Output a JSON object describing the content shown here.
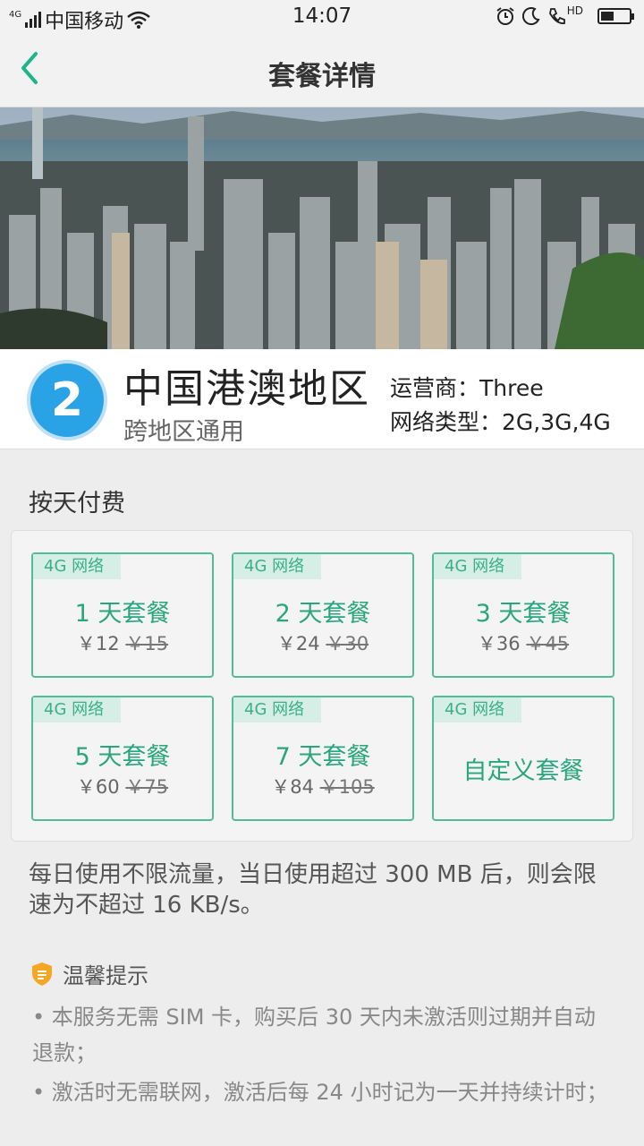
{
  "status_bar": {
    "network": "4G",
    "carrier": "中国移动",
    "time": "14:07",
    "hd": "HD"
  },
  "nav": {
    "back_icon": "chevron-left-icon",
    "title": "套餐详情"
  },
  "region": {
    "badge_number": "2",
    "name": "中国港澳地区",
    "subtitle": "跨地区通用",
    "operator": "运营商：Three",
    "network_types": "网络类型：2G,3G,4G"
  },
  "section_title": "按天付费",
  "plans": [
    {
      "tag": "4G 网络",
      "name": "1 天套餐",
      "price": "￥12",
      "original": "￥15"
    },
    {
      "tag": "4G 网络",
      "name": "2 天套餐",
      "price": "￥24",
      "original": "￥30"
    },
    {
      "tag": "4G 网络",
      "name": "3 天套餐",
      "price": "￥36",
      "original": "￥45"
    },
    {
      "tag": "4G 网络",
      "name": "5 天套餐",
      "price": "￥60",
      "original": "￥75"
    },
    {
      "tag": "4G 网络",
      "name": "7 天套餐",
      "price": "￥84",
      "original": "￥105"
    },
    {
      "tag": "4G 网络",
      "name": "自定义套餐"
    }
  ],
  "description": "每日使用不限流量，当日使用超过 300 MB 后，则会限速为不超过 16 KB/s。",
  "tips": {
    "title": "温馨提示",
    "items": [
      "• 本服务无需 SIM 卡，购买后 30 天内未激活则过期并自动退款；",
      "• 激活时无需联网，激活后每 24 小时记为一天并持续计时；"
    ]
  },
  "colors": {
    "accent": "#1fb58a",
    "plan_border": "#4fbd9a",
    "tag_bg": "#d6eee5",
    "badge": "#2aa3e6"
  }
}
